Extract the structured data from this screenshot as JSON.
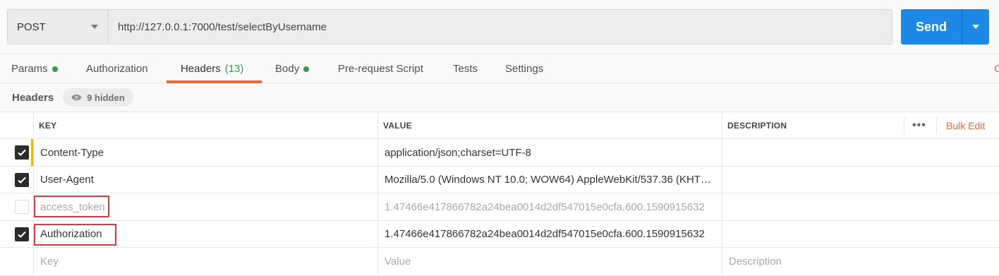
{
  "request": {
    "method": "POST",
    "url": "http://127.0.0.1:7000/test/selectByUsername",
    "send_label": "Send"
  },
  "tabs": [
    {
      "label": "Params",
      "dot": true
    },
    {
      "label": "Authorization"
    },
    {
      "label": "Headers",
      "count": "(13)",
      "active": true
    },
    {
      "label": "Body",
      "dot": true
    },
    {
      "label": "Pre-request Script"
    },
    {
      "label": "Tests"
    },
    {
      "label": "Settings"
    }
  ],
  "tabs_right_partial": "C",
  "headers_section": {
    "title": "Headers",
    "hidden_label": "9 hidden"
  },
  "table": {
    "columns": {
      "key": "KEY",
      "value": "VALUE",
      "description": "DESCRIPTION"
    },
    "more_icon": "•••",
    "bulk_edit": "Bulk Edit",
    "rows": [
      {
        "checked": true,
        "key": "Content-Type",
        "value": "application/json;charset=UTF-8",
        "description": ""
      },
      {
        "checked": true,
        "key": "User-Agent",
        "value": "Mozilla/5.0 (Windows NT 10.0; WOW64) AppleWebKit/537.36 (KHT…",
        "description": ""
      },
      {
        "checked": false,
        "key": "access_token",
        "value": "1.47466e417866782a24bea0014d2df547015e0cfa.600.1590915632",
        "description": ""
      },
      {
        "checked": true,
        "key": "Authorization",
        "value": "1.47466e417866782a24bea0014d2df547015e0cfa.600.1590915632",
        "description": ""
      }
    ],
    "placeholder": {
      "key": "Key",
      "value": "Value",
      "description": "Description"
    }
  },
  "colors": {
    "send": "#1e88e5",
    "accent": "#e76a3c",
    "dot_green": "#2e9e48",
    "highlight_red": "#d9363e",
    "changed_marker": "#f2b600"
  }
}
